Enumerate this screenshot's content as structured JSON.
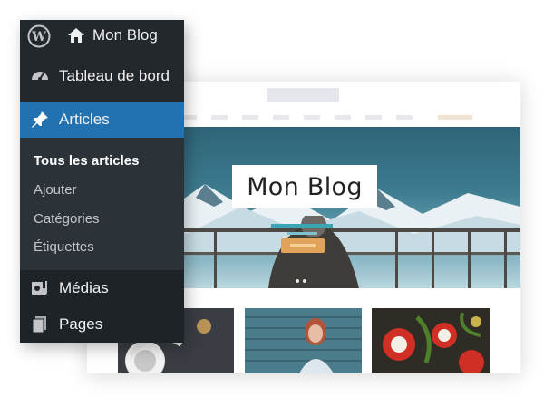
{
  "admin": {
    "site_name": "Mon Blog",
    "menu": {
      "dashboard": "Tableau de bord",
      "articles": "Articles",
      "media": "Médias",
      "pages": "Pages"
    },
    "submenu": {
      "all": "Tous les articles",
      "add": "Ajouter",
      "categories": "Catégories",
      "tags": "Étiquettes"
    },
    "colors": {
      "menu_bg": "#23282d",
      "submenu_bg": "#2c3338",
      "active": "#2271b1"
    }
  },
  "preview": {
    "hero_title": "Mon Blog",
    "accent": "#3aa5b7",
    "button_color": "#e1a35a"
  }
}
